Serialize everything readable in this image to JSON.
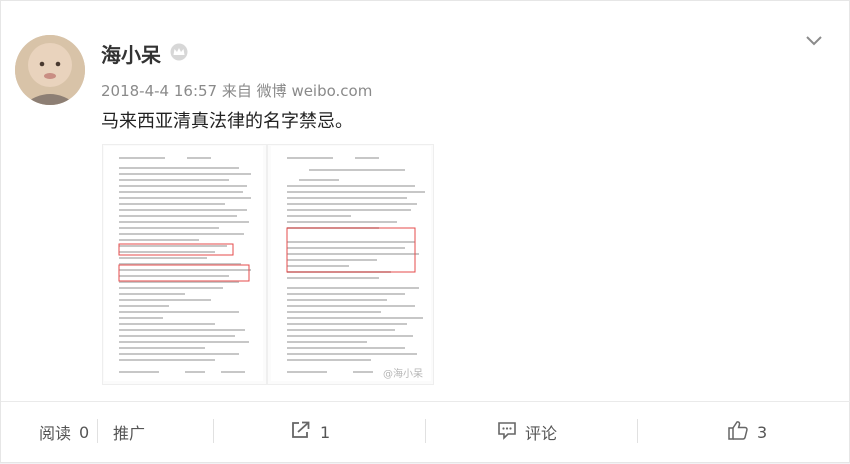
{
  "post": {
    "author_name": "海小呆",
    "date": "2018-4-4 16:57",
    "source_prefix": "来自",
    "source": "微博 weibo.com",
    "text": "马来西亚清真法律的名字禁忌。",
    "watermark": "@海小呆"
  },
  "footer": {
    "read_label": "阅读",
    "read_count": "0",
    "promote_label": "推广",
    "share_count": "1",
    "comment_label": "评论",
    "like_count": "3"
  },
  "colors": {
    "text": "#222222",
    "meta": "#8a8a8a",
    "highlight_box": "#e54b4b"
  }
}
